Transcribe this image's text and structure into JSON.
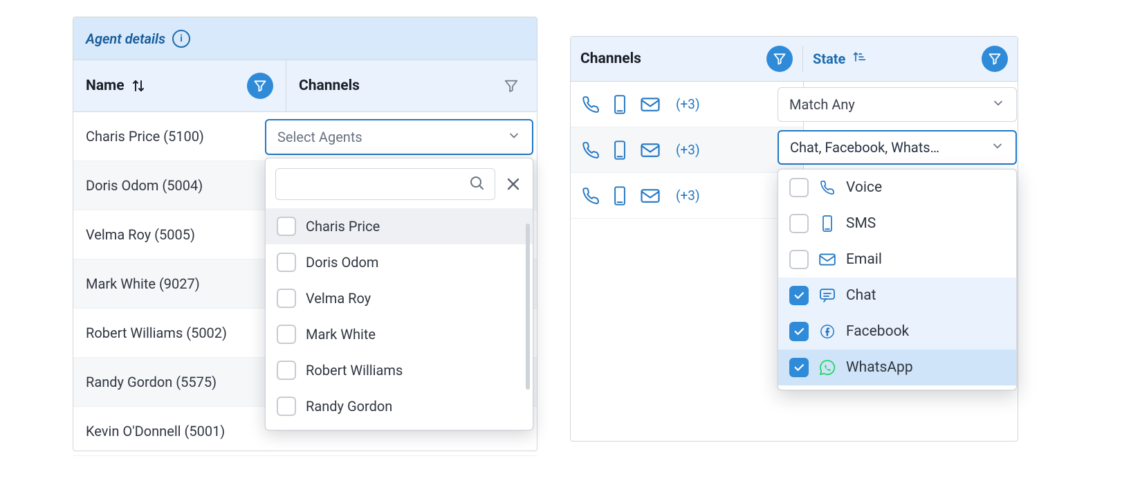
{
  "left_panel": {
    "title": "Agent details",
    "columns": {
      "name_label": "Name",
      "channels_label": "Channels"
    },
    "rows": [
      "Charis Price (5100)",
      "Doris Odom (5004)",
      "Velma Roy (5005)",
      "Mark White (9027)",
      "Robert Williams (5002)",
      "Randy Gordon (5575)",
      "Kevin O'Donnell (5001)"
    ],
    "agent_dropdown": {
      "placeholder": "Select Agents",
      "search_value": "",
      "options": [
        "Charis Price",
        "Doris Odom",
        "Velma Roy",
        "Mark White",
        "Robert Williams",
        "Randy Gordon"
      ],
      "hovered_index": 0
    }
  },
  "right_panel": {
    "columns": {
      "channels_label": "Channels",
      "state_label": "State"
    },
    "channel_rows": [
      {
        "more": "(+3)"
      },
      {
        "more": "(+3)"
      },
      {
        "more": "(+3)"
      }
    ],
    "state_dropdown": {
      "match_label": "Match Any",
      "selected_summary": "Chat, Facebook, Whats…",
      "options": [
        {
          "name": "Voice",
          "icon": "phone-icon",
          "checked": false
        },
        {
          "name": "SMS",
          "icon": "sms-icon",
          "checked": false
        },
        {
          "name": "Email",
          "icon": "email-icon",
          "checked": false
        },
        {
          "name": "Chat",
          "icon": "chat-icon",
          "checked": true
        },
        {
          "name": "Facebook",
          "icon": "facebook-icon",
          "checked": true
        },
        {
          "name": "WhatsApp",
          "icon": "whatsapp-icon",
          "checked": true
        }
      ]
    }
  },
  "icons": {
    "info": "info-icon",
    "sort": "sort-icon",
    "filter": "filter-icon",
    "sort_asc": "sort-asc-icon",
    "search": "search-icon",
    "close": "close-icon",
    "chevron_down": "chevron-down-icon"
  }
}
